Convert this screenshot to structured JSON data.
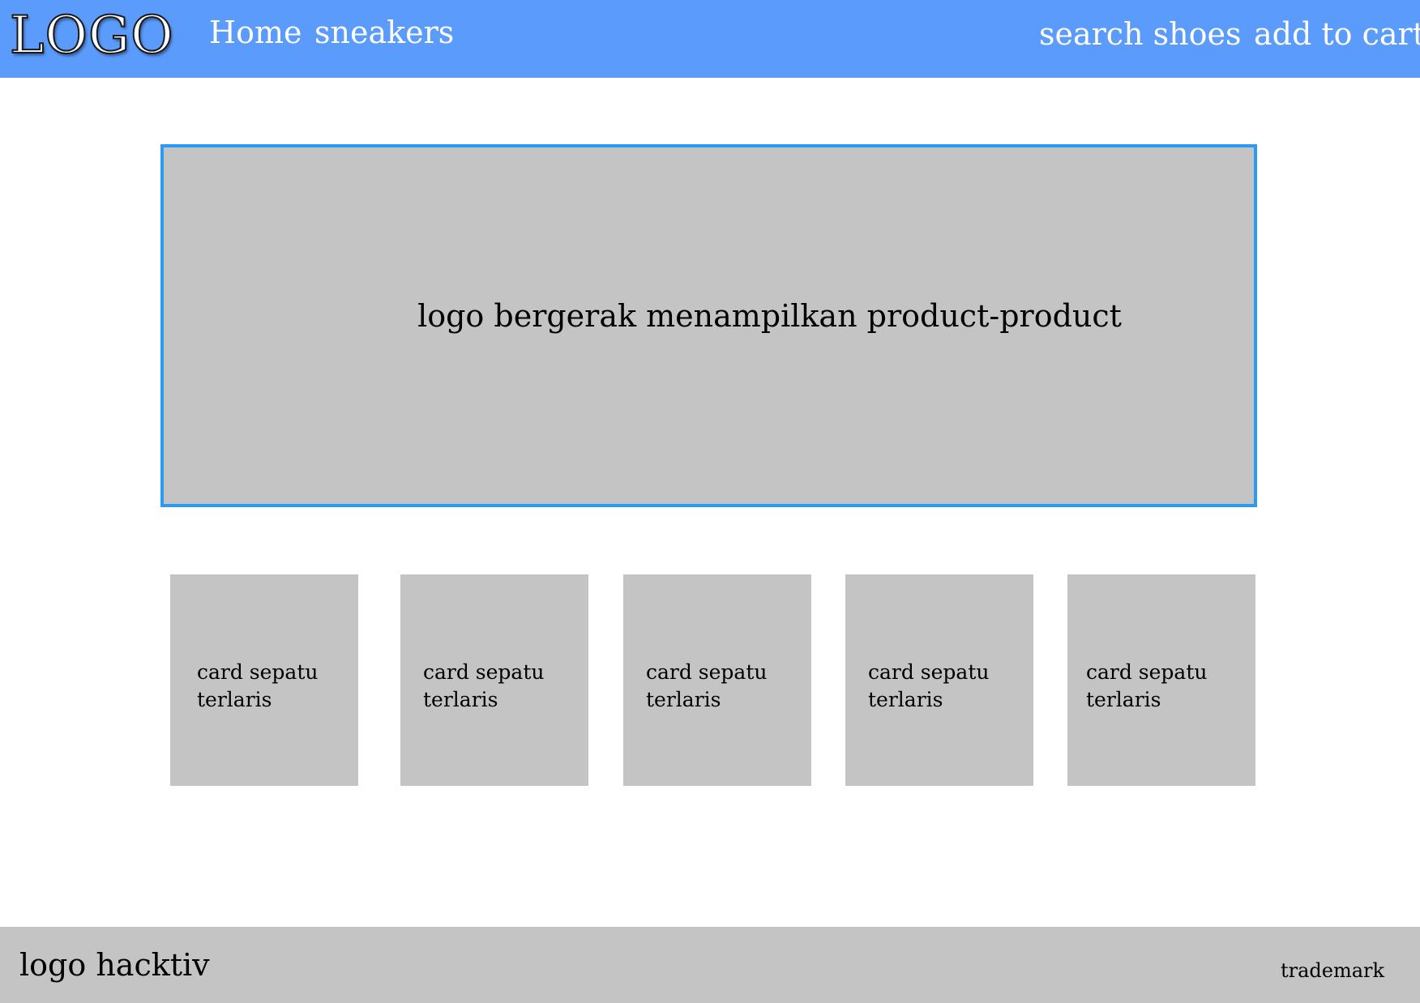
{
  "header": {
    "logo": "LOGO",
    "nav_left": [
      {
        "label": "Home"
      },
      {
        "label": "sneakers"
      }
    ],
    "nav_right": [
      {
        "label": "search shoes"
      },
      {
        "label": "add to cart"
      }
    ]
  },
  "hero": {
    "text": "logo bergerak menampilkan product-product"
  },
  "cards": [
    {
      "line1": "card sepatu",
      "line2": "terlaris"
    },
    {
      "line1": "card sepatu",
      "line2": "terlaris"
    },
    {
      "line1": "card sepatu",
      "line2": "terlaris"
    },
    {
      "line1": "card sepatu",
      "line2": "terlaris"
    },
    {
      "line1": "card sepatu",
      "line2": "terlaris"
    }
  ],
  "footer": {
    "logo": "logo hacktiv",
    "trademark": "trademark"
  },
  "colors": {
    "navbar": "#5b9bfb",
    "placeholder_gray": "#c4c4c4",
    "hero_border": "#2b9af3"
  }
}
